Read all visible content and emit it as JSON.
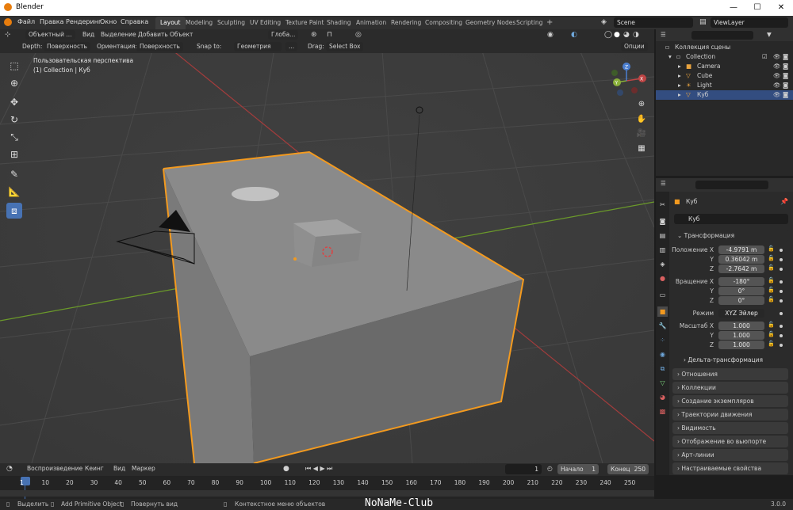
{
  "window": {
    "title": "Blender",
    "min": "—",
    "max": "☐",
    "close": "✕"
  },
  "menu": [
    "Файл",
    "Правка",
    "Рендеринг",
    "Окно",
    "Справка"
  ],
  "workspaces": [
    "Layout",
    "Modeling",
    "Sculpting",
    "UV Editing",
    "Texture Paint",
    "Shading",
    "Animation",
    "Rendering",
    "Compositing",
    "Geometry Nodes",
    "Scripting",
    "+"
  ],
  "scene": {
    "name": "Scene",
    "view_layer": "ViewLayer"
  },
  "viewport_header": {
    "mode": "Объектный ...",
    "view": "Вид",
    "select": "Выделение",
    "add": "Добавить",
    "object": "Объект",
    "transform": "Глоба...",
    "options": "Опции"
  },
  "tool_settings": {
    "depth_label": "Depth:",
    "depth_value": "Поверхность",
    "orient_label": "Ориентация:",
    "orient_value": "Поверхность",
    "snap_label": "Snap to:",
    "snap_value": "Геометрия",
    "snap_extra": "...",
    "drag_label": "Drag:",
    "drag_value": "Select Box"
  },
  "overlay_text": {
    "perspective": "Пользовательская перспектива",
    "collection": "(1) Collection | Куб"
  },
  "outliner": {
    "root": "Коллекция сцены",
    "items": [
      {
        "name": "Collection"
      },
      {
        "name": "Camera"
      },
      {
        "name": "Cube"
      },
      {
        "name": "Light"
      },
      {
        "name": "Куб"
      }
    ]
  },
  "properties": {
    "object_name": "Куб",
    "data_name": "Куб",
    "transform_title": "Трансформация",
    "location_label": "Положение X",
    "location": [
      "-4.9791 m",
      "0.36042 m",
      "-2.7642 m"
    ],
    "rotation_label": "Вращение X",
    "rotation": [
      "-180°",
      "0°",
      "0°"
    ],
    "mode_label": "Режим",
    "mode_value": "XYZ Эйлер",
    "scale_label": "Масштаб X",
    "scale": [
      "1.000",
      "1.000",
      "1.000"
    ],
    "y_label": "Y",
    "z_label": "Z",
    "delta": "Дельта-трансформация",
    "panels": [
      "Отношения",
      "Коллекции",
      "Создание экземпляров",
      "Траектории движения",
      "Видимость",
      "Отображение во вьюпорте",
      "Арт-линии",
      "Настраиваемые свойства"
    ]
  },
  "timeline": {
    "playback": "Воспроизведение",
    "keying": "Кеинг",
    "view": "Вид",
    "marker": "Маркер",
    "current_frame": "1",
    "start_label": "Начало",
    "start": "1",
    "end_label": "Конец",
    "end": "250",
    "ticks": [
      "1",
      "10",
      "20",
      "30",
      "40",
      "50",
      "60",
      "70",
      "80",
      "90",
      "100",
      "110",
      "120",
      "130",
      "140",
      "150",
      "160",
      "170",
      "180",
      "190",
      "200",
      "210",
      "220",
      "230",
      "240",
      "250"
    ]
  },
  "statusbar": {
    "select": "Выделить",
    "add_primitive": "Add Primitive Object",
    "rotate": "Повернуть вид",
    "context": "Контекстное меню объектов",
    "version": "3.0.0",
    "watermark": "NoNaMe-Club"
  },
  "colors": {
    "accent": "#4772b3",
    "selection_outline": "#f39a1f",
    "x_axis": "#a33c3c",
    "y_axis": "#6b9a2a"
  },
  "gizmo": {
    "x": "X",
    "y": "Y",
    "z": "Z"
  }
}
